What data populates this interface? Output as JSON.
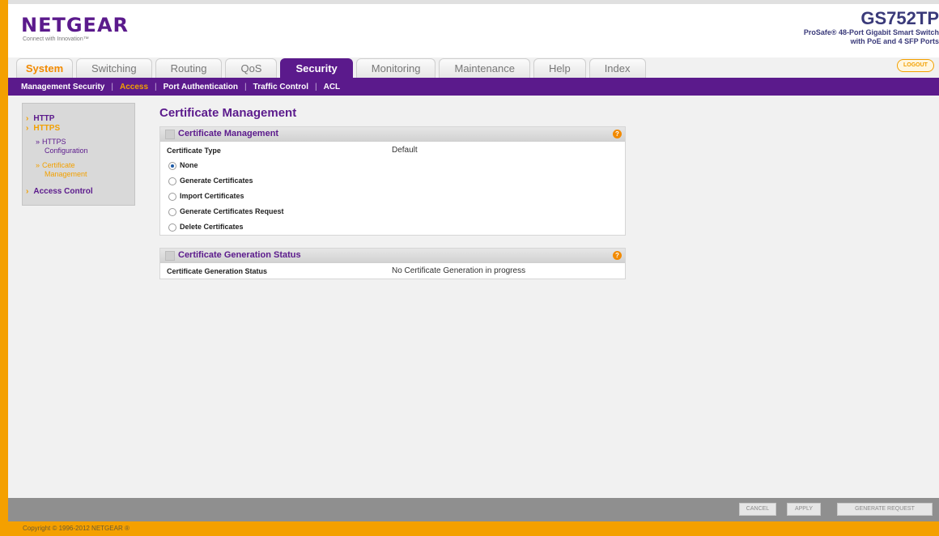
{
  "brand": {
    "logo": "NETGEAR",
    "tagline": "Connect with Innovation™",
    "model": "GS752TP",
    "model_description_line1": "ProSafe® 48-Port Gigabit Smart Switch",
    "model_description_line2": "with PoE and 4 SFP Ports"
  },
  "tabs": [
    {
      "label": "System"
    },
    {
      "label": "Switching"
    },
    {
      "label": "Routing"
    },
    {
      "label": "QoS"
    },
    {
      "label": "Security",
      "active": true
    },
    {
      "label": "Monitoring"
    },
    {
      "label": "Maintenance"
    },
    {
      "label": "Help"
    },
    {
      "label": "Index"
    }
  ],
  "logout_label": "LOGOUT",
  "subnav": [
    {
      "label": "Management Security"
    },
    {
      "label": "Access",
      "current": true
    },
    {
      "label": "Port Authentication"
    },
    {
      "label": "Traffic Control"
    },
    {
      "label": "ACL"
    }
  ],
  "sidebar": {
    "http": "HTTP",
    "https": "HTTPS",
    "https_configuration_1": "HTTPS",
    "https_configuration_2": "Configuration",
    "certificate_management_1": "Certificate",
    "certificate_management_2": "Management",
    "access_control": "Access Control"
  },
  "page_title": "Certificate Management",
  "panel1": {
    "title": "Certificate Management",
    "certificate_type_label": "Certificate Type",
    "certificate_type_value": "Default",
    "options": [
      {
        "label": "None",
        "selected": true
      },
      {
        "label": "Generate Certificates",
        "selected": false
      },
      {
        "label": "Import Certificates",
        "selected": false
      },
      {
        "label": "Generate Certificates Request",
        "selected": false
      },
      {
        "label": "Delete Certificates",
        "selected": false
      }
    ]
  },
  "panel2": {
    "title": "Certificate Generation Status",
    "status_label": "Certificate Generation Status",
    "status_value": "No Certificate Generation in progress"
  },
  "buttons": {
    "cancel": "CANCEL",
    "apply": "APPLY",
    "generate_request": "GENERATE REQUEST"
  },
  "footer": {
    "copyright": "Copyright © 1996-2012 NETGEAR ®"
  },
  "colors": {
    "brand_purple": "#5b1a8c",
    "accent_orange": "#f4a000"
  }
}
